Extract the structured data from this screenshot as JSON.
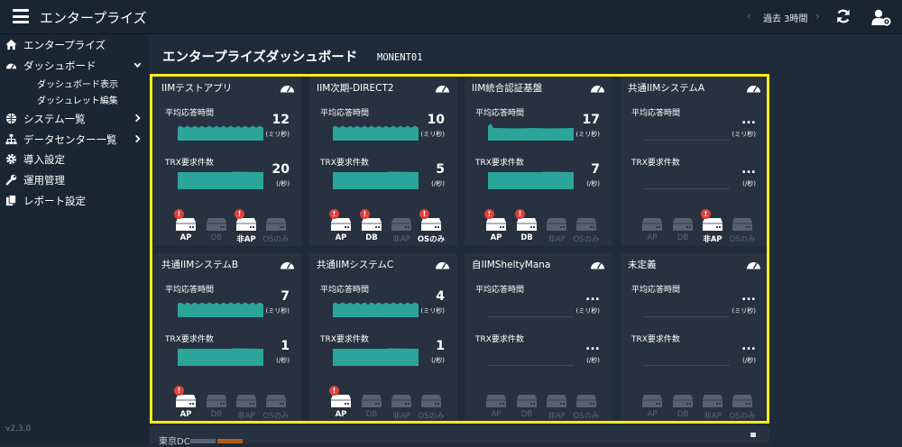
{
  "app": {
    "title": "エンタープライズ"
  },
  "topbar": {
    "prev": "‹",
    "period": "過去 3時間",
    "next": "›"
  },
  "sidebar": {
    "items": [
      {
        "label": "エンタープライズ",
        "icon": "home-icon"
      },
      {
        "label": "ダッシュボード",
        "icon": "dashboard-icon",
        "expanded": true
      },
      {
        "label": "システム一覧",
        "icon": "globe-icon"
      },
      {
        "label": "データセンター一覧",
        "icon": "sitemap-icon"
      },
      {
        "label": "導入設定",
        "icon": "gear-icon"
      },
      {
        "label": "運用管理",
        "icon": "wrench-icon"
      },
      {
        "label": "レポート設定",
        "icon": "copy-icon"
      }
    ],
    "subitems": [
      {
        "label": "ダッシュボード表示"
      },
      {
        "label": "ダッシュレット編集"
      }
    ],
    "version": "v2.3.0"
  },
  "main": {
    "title": "エンタープライズダッシュボード",
    "code": "MONENT01"
  },
  "metric_labels": {
    "avg": "平均応答時間",
    "trx": "TRX要求件数",
    "avg_unit": "(ミリ秒)",
    "trx_unit": "(/秒)"
  },
  "server_labels": [
    "AP",
    "DB",
    "非AP",
    "OSのみ"
  ],
  "cards": [
    {
      "title": "IIMテストアプリ",
      "avg": "12",
      "trx": "20",
      "avg_trend": "wave",
      "trx_trend": "flat",
      "servers": [
        {
          "on": true,
          "alert": true
        },
        {
          "on": false,
          "alert": false
        },
        {
          "on": true,
          "alert": true
        },
        {
          "on": false,
          "alert": false
        }
      ]
    },
    {
      "title": "IIM次期-DIRECT2",
      "avg": "10",
      "trx": "5",
      "avg_trend": "wave",
      "trx_trend": "flat",
      "servers": [
        {
          "on": true,
          "alert": true
        },
        {
          "on": true,
          "alert": true
        },
        {
          "on": false,
          "alert": false
        },
        {
          "on": true,
          "alert": true
        }
      ]
    },
    {
      "title": "IIM統合認証基盤",
      "avg": "17",
      "trx": "7",
      "avg_trend": "peak",
      "trx_trend": "flat",
      "servers": [
        {
          "on": true,
          "alert": true
        },
        {
          "on": true,
          "alert": true
        },
        {
          "on": false,
          "alert": false
        },
        {
          "on": false,
          "alert": false
        }
      ]
    },
    {
      "title": "共通IIMシステムA",
      "avg": "...",
      "trx": "...",
      "avg_trend": "none",
      "trx_trend": "none",
      "servers": [
        {
          "on": false,
          "alert": false
        },
        {
          "on": false,
          "alert": false
        },
        {
          "on": true,
          "alert": true
        },
        {
          "on": false,
          "alert": false
        }
      ]
    },
    {
      "title": "共通IIMシステムB",
      "avg": "7",
      "trx": "1",
      "avg_trend": "wave",
      "trx_trend": "flat",
      "servers": [
        {
          "on": true,
          "alert": true
        },
        {
          "on": false,
          "alert": false
        },
        {
          "on": false,
          "alert": false
        },
        {
          "on": false,
          "alert": false
        }
      ]
    },
    {
      "title": "共通IIMシステムC",
      "avg": "4",
      "trx": "1",
      "avg_trend": "wave",
      "trx_trend": "flat",
      "servers": [
        {
          "on": true,
          "alert": true
        },
        {
          "on": false,
          "alert": false
        },
        {
          "on": false,
          "alert": false
        },
        {
          "on": false,
          "alert": false
        }
      ]
    },
    {
      "title": "自IIMSheltyMana",
      "avg": "...",
      "trx": "...",
      "avg_trend": "none",
      "trx_trend": "none",
      "servers": [
        {
          "on": false,
          "alert": false
        },
        {
          "on": false,
          "alert": false
        },
        {
          "on": false,
          "alert": false
        },
        {
          "on": false,
          "alert": false
        }
      ]
    },
    {
      "title": "未定義",
      "avg": "...",
      "trx": "...",
      "avg_trend": "none",
      "trx_trend": "none",
      "servers": [
        {
          "on": false,
          "alert": false
        },
        {
          "on": false,
          "alert": false
        },
        {
          "on": false,
          "alert": false
        },
        {
          "on": false,
          "alert": false
        }
      ]
    }
  ],
  "bottom": {
    "label": "東京DC"
  },
  "colors": {
    "accent": "#2ba59a",
    "highlight": "#f7ec1b",
    "alert": "#e0403c",
    "card": "#27313f",
    "background": "#1f2b39"
  }
}
